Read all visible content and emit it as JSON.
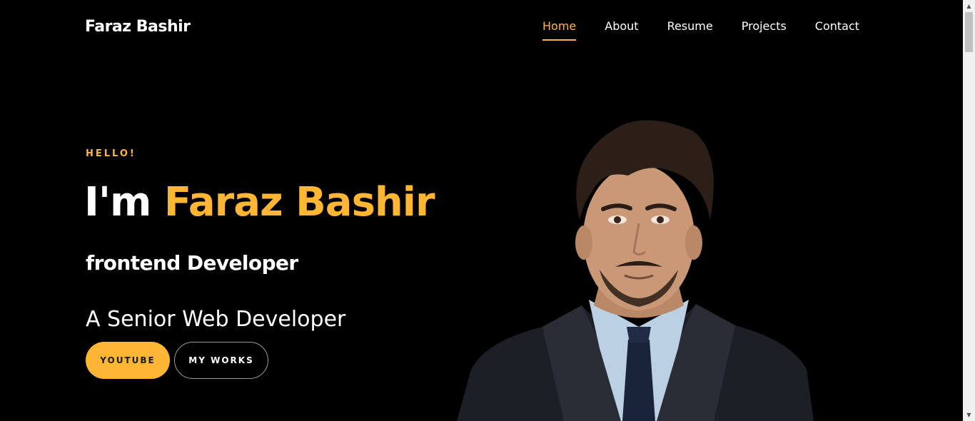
{
  "header": {
    "logo": "Faraz Bashir",
    "nav": [
      {
        "label": "Home",
        "active": true
      },
      {
        "label": "About",
        "active": false
      },
      {
        "label": "Resume",
        "active": false
      },
      {
        "label": "Projects",
        "active": false
      },
      {
        "label": "Contact",
        "active": false
      }
    ]
  },
  "hero": {
    "greeting": "HELLO!",
    "title_prefix": "I'm",
    "name": "Faraz Bashir",
    "role": "frontend Developer",
    "tagline": "A Senior Web Developer",
    "buttons": {
      "primary": "YOUTUBE",
      "secondary": "MY WORKS"
    },
    "portrait_alt": "portrait"
  },
  "colors": {
    "accent": "#ffb733",
    "background": "#000000",
    "text": "#ffffff"
  },
  "icons": {
    "scroll_up": "chevron-up-icon",
    "scroll_down": "chevron-down-icon"
  }
}
